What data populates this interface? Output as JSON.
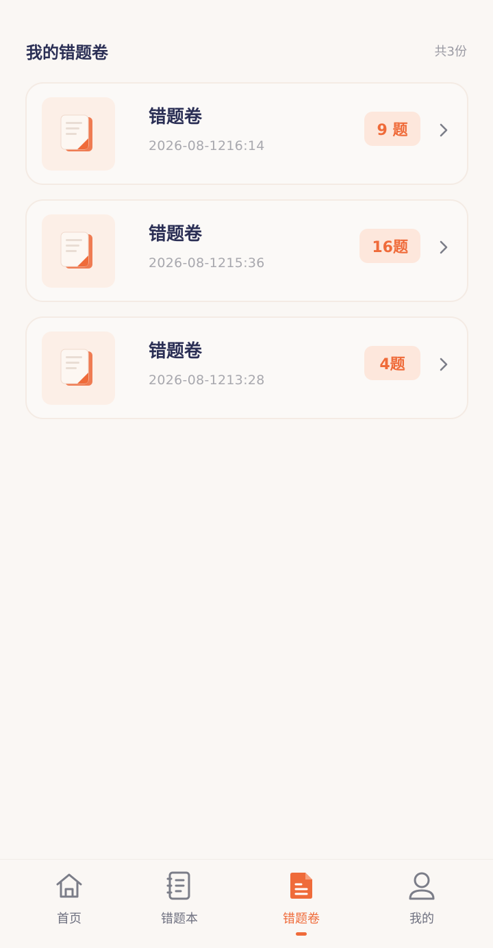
{
  "header": {
    "title": "我的错题卷",
    "count": "共3份"
  },
  "papers": [
    {
      "title": "错题卷",
      "date": "2026-08-1216:14",
      "badge": "9 题"
    },
    {
      "title": "错题卷",
      "date": "2026-08-1215:36",
      "badge": "16题"
    },
    {
      "title": "错题卷",
      "date": "2026-08-1213:28",
      "badge": "4题"
    }
  ],
  "tabbar": {
    "items": [
      {
        "label": "首页",
        "icon": "home-icon"
      },
      {
        "label": "错题本",
        "icon": "notebook-icon"
      },
      {
        "label": "错题卷",
        "icon": "document-icon",
        "active": true
      },
      {
        "label": "我的",
        "icon": "user-icon"
      }
    ]
  },
  "colors": {
    "accent": "#ef6b3a",
    "title": "#2b2f55",
    "background": "#faf7f4"
  }
}
